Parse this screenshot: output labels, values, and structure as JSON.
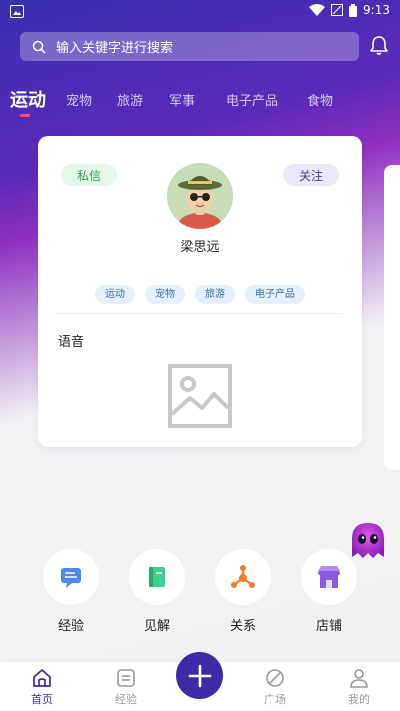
{
  "status": {
    "time": "9:13"
  },
  "search": {
    "placeholder": "输入关键字进行搜索"
  },
  "tabs": [
    {
      "label": "运动",
      "active": true
    },
    {
      "label": "宠物"
    },
    {
      "label": "旅游"
    },
    {
      "label": "军事"
    },
    {
      "label": "电子产品"
    },
    {
      "label": "食物"
    }
  ],
  "card": {
    "message_label": "私信",
    "follow_label": "关注",
    "username": "梁思远",
    "tags": [
      "运动",
      "宠物",
      "旅游",
      "电子产品"
    ],
    "voice_label": "语音"
  },
  "actions": [
    {
      "label": "经验",
      "icon": "chat-card-icon",
      "color": "#4a8be8"
    },
    {
      "label": "见解",
      "icon": "book-icon",
      "color": "#3fcf8e"
    },
    {
      "label": "关系",
      "icon": "network-icon",
      "color": "#f07a2a"
    },
    {
      "label": "店铺",
      "icon": "store-icon",
      "color": "#8a5ae0"
    }
  ],
  "nav": {
    "home": "首页",
    "experience": "经验",
    "square": "广场",
    "mine": "我的"
  },
  "colors": {
    "accent": "#3d2aa6",
    "tab_indicator": "#ff4d6d"
  }
}
